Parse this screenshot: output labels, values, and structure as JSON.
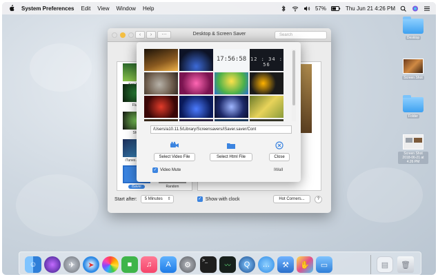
{
  "menubar": {
    "apple_icon": "apple-icon",
    "app_name": "System Preferences",
    "menus": [
      "Edit",
      "View",
      "Window",
      "Help"
    ],
    "battery": "57%",
    "clock": "Thu Jun 21  4:26 PM",
    "status_icons": [
      "bluetooth-icon",
      "wifi-icon",
      "volume-icon",
      "battery-icon",
      "search-icon",
      "siri-icon",
      "menu-icon"
    ]
  },
  "desktop": {
    "icons": [
      {
        "kind": "folder",
        "label": "Desktop"
      },
      {
        "kind": "image",
        "label": "Screen Shot"
      },
      {
        "kind": "folder",
        "label": "Folder"
      },
      {
        "kind": "image",
        "label": "Screen Shot 2018-06-21 at 4.26 PM"
      }
    ]
  },
  "window": {
    "title": "Desktop & Screen Saver",
    "search_placeholder": "Search",
    "nav_back": "‹",
    "nav_forward": "›",
    "grid_button": "⋯",
    "savers": [
      {
        "label": "Ken Burns"
      },
      {
        "label": "Flurry"
      },
      {
        "label": "Shell"
      },
      {
        "label": "iTunes Artwork"
      },
      {
        "label": "iSaver",
        "selected": true
      },
      {
        "label": "Random"
      }
    ],
    "start_after_label": "Start after:",
    "start_after_value": "5 Minutes",
    "show_clock_label": "Show with clock",
    "hot_corners_label": "Hot Corners...",
    "help_label": "?"
  },
  "sheet": {
    "tiles": [
      {
        "kind": "road"
      },
      {
        "kind": "stage"
      },
      {
        "kind": "clock-light",
        "text": "17:56:58"
      },
      {
        "kind": "clock-dark",
        "text": "12 : 34 : 56"
      },
      {
        "kind": "cat"
      },
      {
        "kind": "pink"
      },
      {
        "kind": "green"
      },
      {
        "kind": "sunflower"
      },
      {
        "kind": "red"
      },
      {
        "kind": "blue"
      },
      {
        "kind": "night"
      },
      {
        "kind": "yellow"
      },
      {
        "kind": "row4a"
      },
      {
        "kind": "row4b"
      },
      {
        "kind": "row4c"
      },
      {
        "kind": "row4d"
      }
    ],
    "path": "/Users/a10.11.5/Library/Screensavers/iSaver.saver/Cont",
    "select_video_label": "Select Video File",
    "select_html_label": "Select Html File",
    "close_label": "Close",
    "video_mute_label": "Video Mute",
    "wall_label": "IWall"
  },
  "dock": {
    "apps": [
      {
        "name": "finder-icon",
        "color": "#2f7fd8"
      },
      {
        "name": "siri-icon",
        "color": "#5b3fc7"
      },
      {
        "name": "launchpad-icon",
        "color": "#8a8f98"
      },
      {
        "name": "safari-icon",
        "color": "#2f8be6"
      },
      {
        "name": "photos-icon",
        "color": "#f0f0f0"
      },
      {
        "name": "facetime-icon",
        "color": "#3fb54a"
      },
      {
        "name": "music-icon",
        "color": "#f5446a"
      },
      {
        "name": "app-store-icon",
        "color": "#2c8cf2"
      },
      {
        "name": "system-preferences-icon",
        "color": "#7d8087"
      },
      {
        "name": "terminal-icon",
        "color": "#222222"
      },
      {
        "name": "activity-monitor-icon",
        "color": "#1f2a25"
      },
      {
        "name": "quicktime-icon",
        "color": "#1e4f8f"
      },
      {
        "name": "messages-icon",
        "color": "#47a6f5"
      },
      {
        "name": "xcode-icon",
        "color": "#3a78d6"
      },
      {
        "name": "paint-icon",
        "color": "#e24f8a"
      },
      {
        "name": "screen-sharing-icon",
        "color": "#2f7fd8"
      },
      {
        "name": "document-icon",
        "color": "#e9edf2"
      },
      {
        "name": "trash-icon",
        "color": "#dfe3e8"
      }
    ]
  }
}
